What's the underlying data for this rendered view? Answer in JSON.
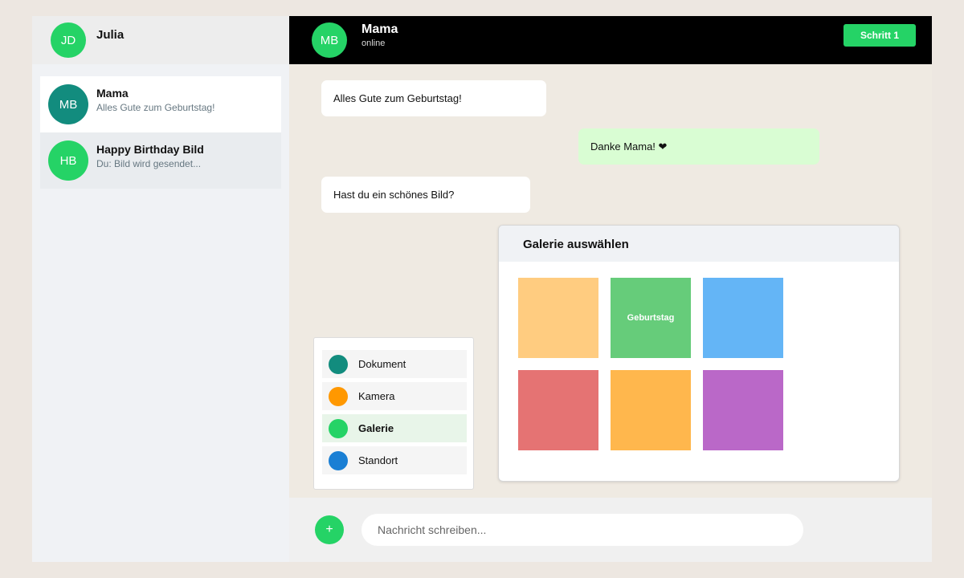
{
  "sidebar": {
    "me": {
      "initials": "JD",
      "name": "Julia"
    },
    "chats": [
      {
        "initials": "MB",
        "name": "Mama",
        "preview": "Alles Gute zum Geburtstag!",
        "avatar_color": "#128c7e"
      },
      {
        "initials": "HB",
        "name": "Happy Birthday Bild",
        "preview": "Du: Bild wird gesendet...",
        "avatar_color": "#25d366"
      }
    ]
  },
  "header": {
    "initials": "MB",
    "contact_name": "Mama",
    "status": "online",
    "step_label": "Schritt 1"
  },
  "messages": [
    {
      "direction": "in",
      "text": "Alles Gute zum Geburtstag!"
    },
    {
      "direction": "out",
      "text": "Danke Mama! ❤"
    },
    {
      "direction": "in",
      "text": "Hast du ein schönes Bild?"
    }
  ],
  "gallery": {
    "title": "Galerie auswählen",
    "thumbnails": [
      {
        "color": "#ffcc80",
        "label": ""
      },
      {
        "color": "#66cc7a",
        "label": "Geburtstag"
      },
      {
        "color": "#64b5f6",
        "label": ""
      },
      {
        "color": "#e57373",
        "label": ""
      },
      {
        "color": "#ffb74d",
        "label": ""
      },
      {
        "color": "#ba68c8",
        "label": ""
      }
    ]
  },
  "attach_menu": {
    "items": [
      {
        "label": "Dokument",
        "icon": "document-icon",
        "color": "#128c7e",
        "selected": false
      },
      {
        "label": "Kamera",
        "icon": "camera-icon",
        "color": "#ff9800",
        "selected": false
      },
      {
        "label": "Galerie",
        "icon": "gallery-icon",
        "color": "#25d366",
        "selected": true
      },
      {
        "label": "Standort",
        "icon": "location-icon",
        "color": "#1a7fd4",
        "selected": false
      }
    ]
  },
  "composer": {
    "add_symbol": "+",
    "placeholder": "Nachricht schreiben..."
  },
  "colors": {
    "accent": "#25d366",
    "header_bg": "#000000",
    "outgoing_bubble": "#d9fdd3"
  }
}
